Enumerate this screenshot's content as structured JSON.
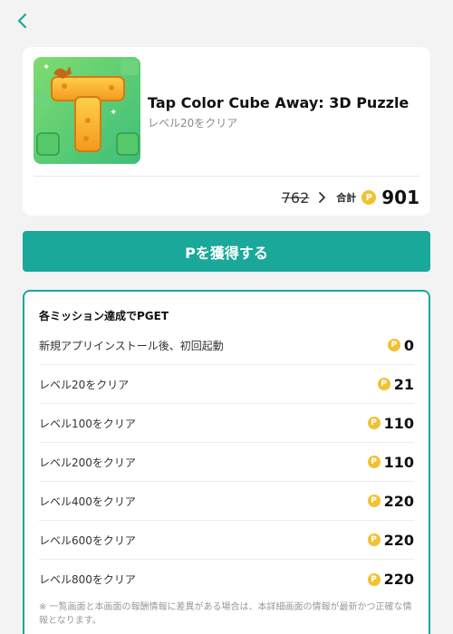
{
  "header": {
    "back_icon": "chevron-left-icon"
  },
  "app": {
    "title": "Tap Color Cube Away: 3D Puzzle",
    "subtitle": "レベル20をクリア",
    "old_points": "762",
    "total_label": "合計",
    "total_points": "901",
    "coin_symbol": "P"
  },
  "cta": {
    "label": "Pを獲得する"
  },
  "missions": {
    "heading": "各ミッション達成でPGET",
    "items": [
      {
        "label": "新規アプリインストール後、初回起動",
        "points": "0"
      },
      {
        "label": "レベル20をクリア",
        "points": "21"
      },
      {
        "label": "レベル100をクリア",
        "points": "110"
      },
      {
        "label": "レベル200をクリア",
        "points": "110"
      },
      {
        "label": "レベル400をクリア",
        "points": "220"
      },
      {
        "label": "レベル600をクリア",
        "points": "220"
      },
      {
        "label": "レベル800をクリア",
        "points": "220"
      }
    ],
    "disclaimer": "※ 一覧画面と本画面の報酬情報に差異がある場合は、本詳細画面の情報が最新かつ正確な情報となります。"
  },
  "colors": {
    "accent": "#1aa89a",
    "coin": "#f1c232",
    "background": "#f3f3f3"
  }
}
